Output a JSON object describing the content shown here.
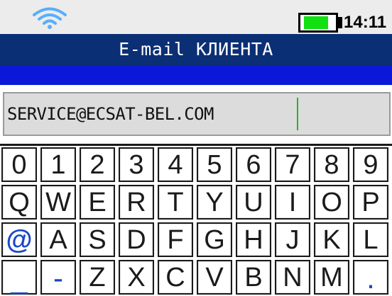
{
  "status": {
    "time": "14:11",
    "wifi_icon": "wifi-icon",
    "battery_icon": "battery-icon",
    "battery_level": 0.85
  },
  "title": "E-mail КЛИЕНТА",
  "email_field": {
    "value": "SERVICE@ECSAT-BEL.COM"
  },
  "keyboard": {
    "rows": [
      [
        "0",
        "1",
        "2",
        "3",
        "4",
        "5",
        "6",
        "7",
        "8",
        "9"
      ],
      [
        "Q",
        "W",
        "E",
        "R",
        "T",
        "Y",
        "U",
        "I",
        "O",
        "P"
      ],
      [
        "@",
        "A",
        "S",
        "D",
        "F",
        "G",
        "H",
        "J",
        "K",
        "L"
      ],
      [
        "_",
        "-",
        "Z",
        "X",
        "C",
        "V",
        "B",
        "N",
        "M",
        "."
      ]
    ]
  },
  "colors": {
    "title_bar": "#0b2f74",
    "band": "#0c18d8",
    "accent": "#1a47c7",
    "battery": "#11e011",
    "cursor": "#23b623"
  }
}
